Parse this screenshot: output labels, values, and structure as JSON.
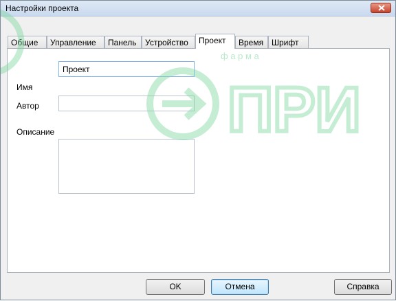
{
  "window": {
    "title": "Настройки проекта"
  },
  "tabs": [
    {
      "label": "Общие"
    },
    {
      "label": "Управление"
    },
    {
      "label": "Панель"
    },
    {
      "label": "Устройство"
    },
    {
      "label": "Проект",
      "active": true
    },
    {
      "label": "Время"
    },
    {
      "label": "Шрифт"
    }
  ],
  "form": {
    "name_label": "Имя",
    "name_value": "Проект",
    "author_label": "Автор",
    "author_value": "",
    "description_label": "Описание",
    "description_value": ""
  },
  "buttons": {
    "ok_label": "OK",
    "cancel_label": "Отмена",
    "help_label": "Справка"
  },
  "watermark": {
    "text_main": "ПРИ",
    "text_small": "ф а р м а"
  },
  "colors": {
    "watermark_green": "#7fd8a0",
    "accent_blue": "#3c7fb1"
  }
}
